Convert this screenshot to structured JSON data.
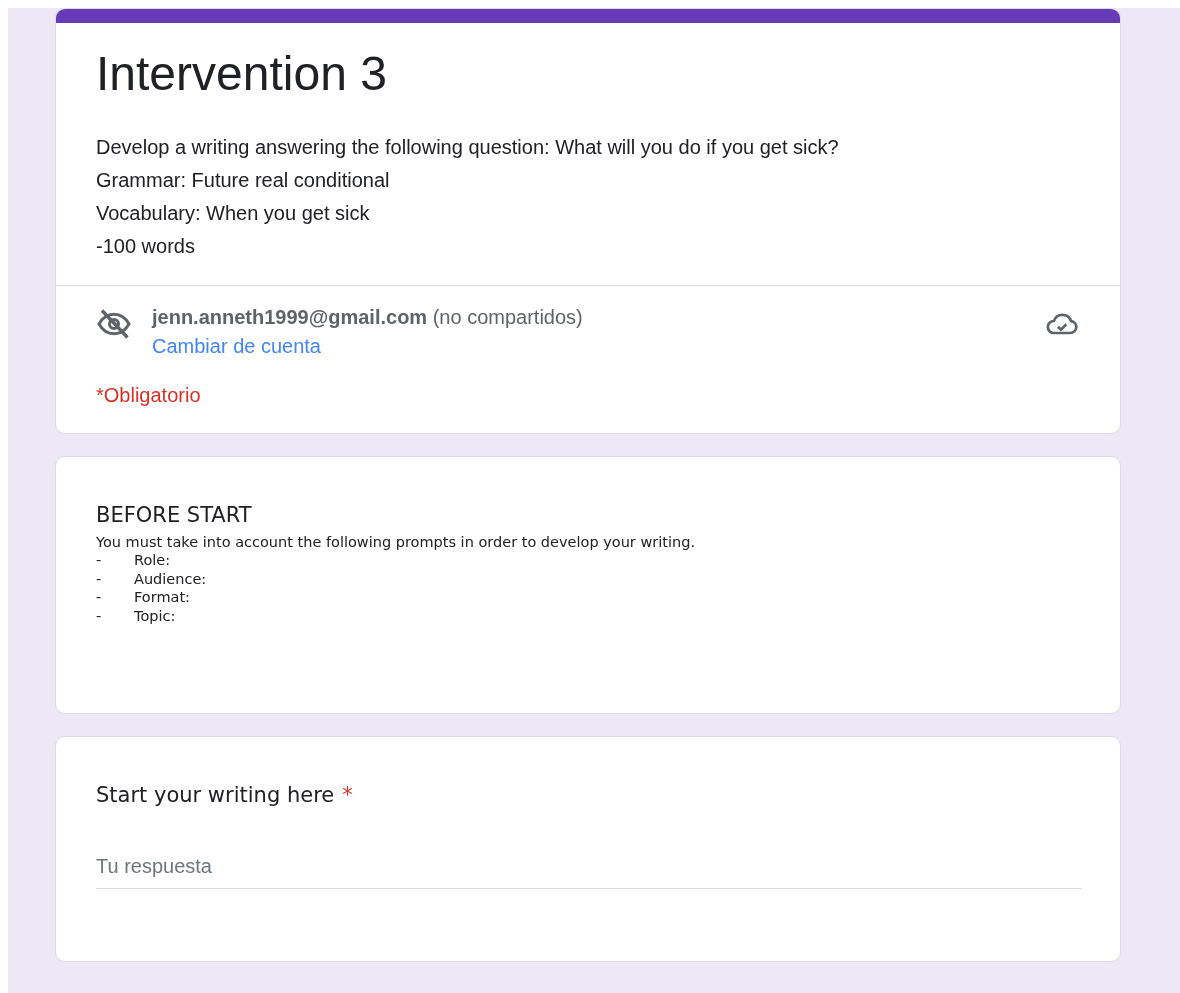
{
  "header": {
    "title": "Intervention 3",
    "description": [
      "Develop a writing answering the following question: What will you do if you get sick?",
      "Grammar: Future real conditional",
      "Vocabulary: When you get sick",
      "-100 words"
    ],
    "account": {
      "email_line": "**jenn.anneth1999@gmail.com** (no compartidos)",
      "switch_link": "Cambiar de cuenta"
    },
    "required_note": "*Obligatorio"
  },
  "section": {
    "title": "BEFORE START",
    "intro": "You must take into account the following prompts in order to develop your writing.",
    "items": [
      {
        "marker": "-",
        "label": "Role:"
      },
      {
        "marker": "-",
        "label": "Audience:"
      },
      {
        "marker": "-",
        "label": "Format:"
      },
      {
        "marker": "-",
        "label": "Topic:"
      }
    ]
  },
  "question": {
    "title": "Start your writing here",
    "required": true,
    "required_mark": "*",
    "placeholder": "Tu respuesta"
  }
}
